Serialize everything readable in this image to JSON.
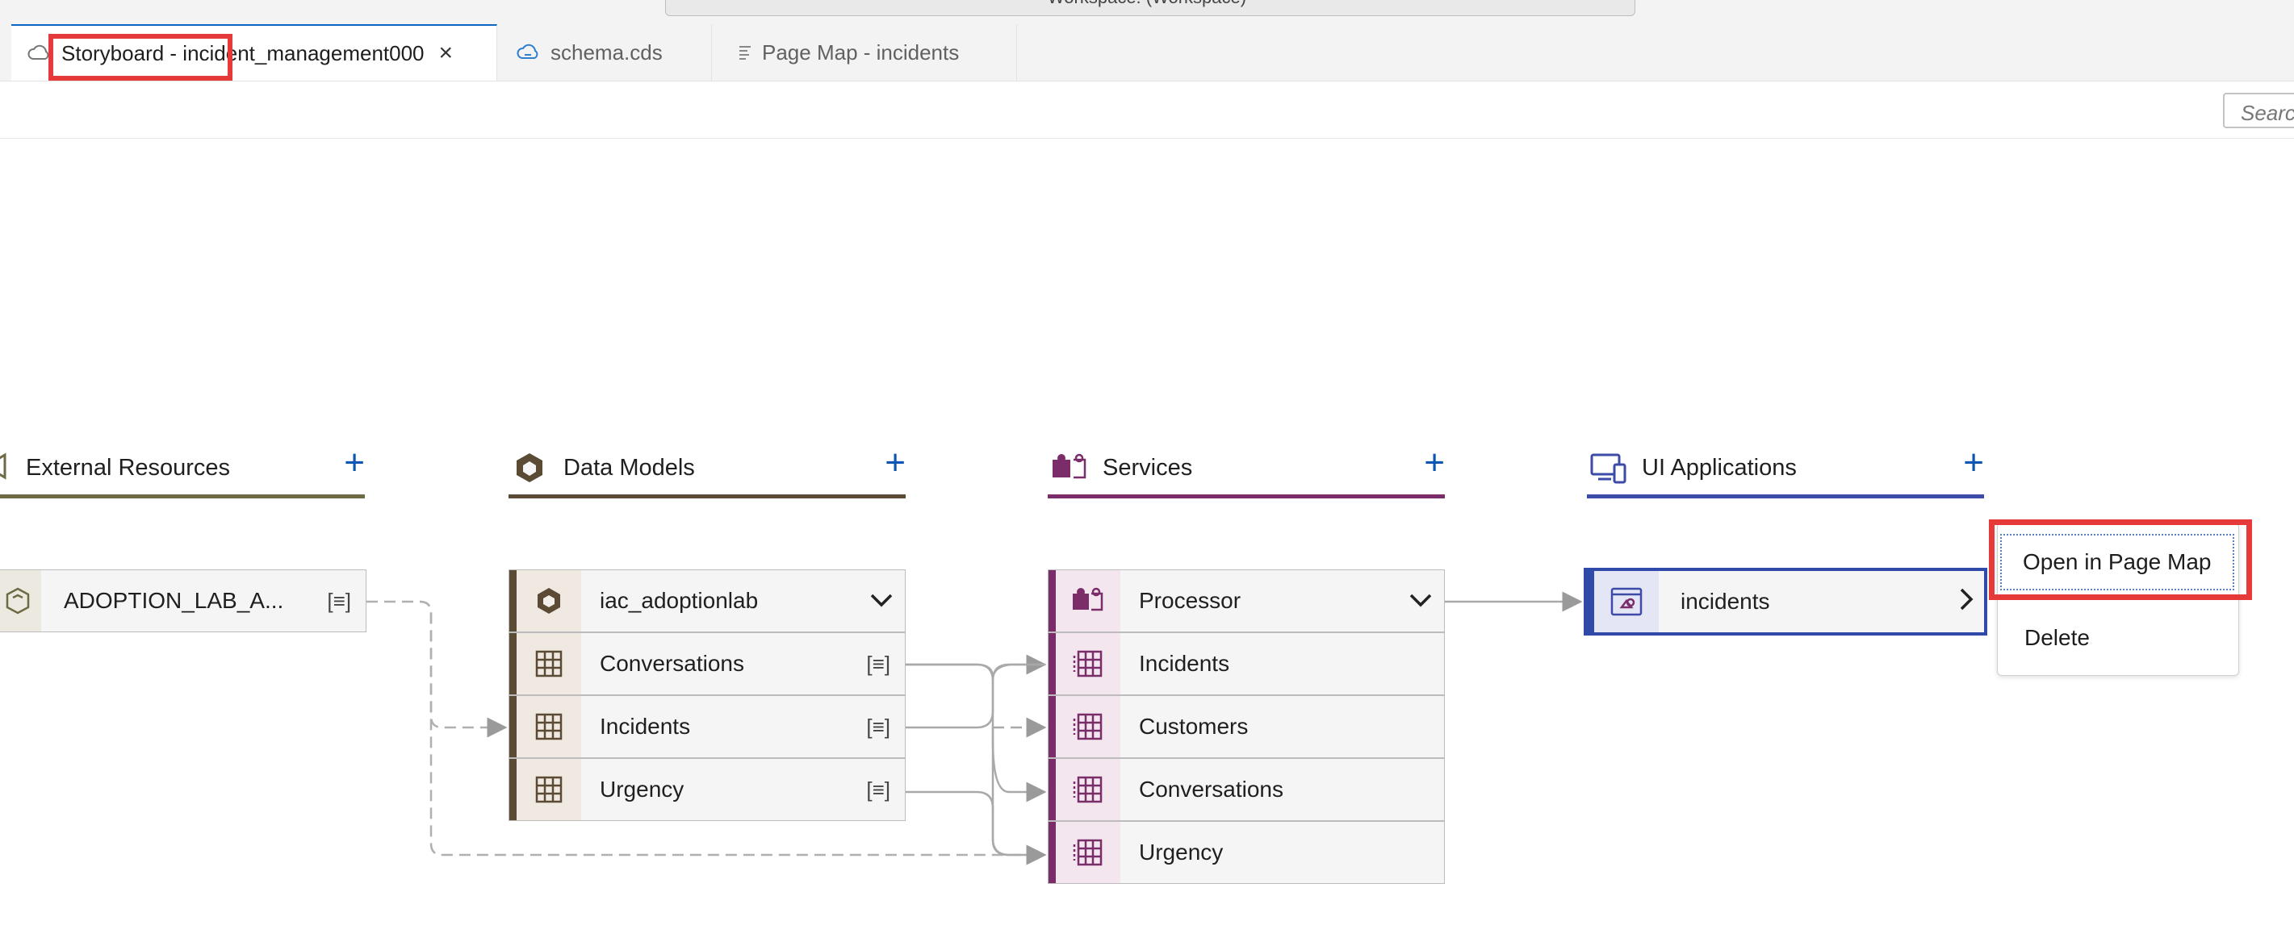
{
  "window": {
    "command_center_text": "Workspace: (Workspace)"
  },
  "tabs": [
    {
      "label": "Storyboard - incident_management000",
      "active": true,
      "icon": "storyboard-cloud-icon"
    },
    {
      "label": "schema.cds",
      "active": false,
      "icon": "cds-cloud-icon"
    },
    {
      "label": "Page Map - incidents",
      "active": false,
      "icon": "page-map-icon"
    }
  ],
  "toolbar": {
    "search_placeholder": "Search"
  },
  "columns": {
    "external": {
      "title": "External Resources",
      "color": "#6d6a44"
    },
    "models": {
      "title": "Data Models",
      "color": "#5b4a34"
    },
    "services": {
      "title": "Services",
      "color": "#7b2d6a"
    },
    "ui": {
      "title": "UI Applications",
      "color": "#3d4ba8"
    }
  },
  "external_resources": [
    {
      "label": "ADOPTION_LAB_A..."
    }
  ],
  "data_models": {
    "group": "iac_adoptionlab",
    "entities": [
      "Conversations",
      "Incidents",
      "Urgency"
    ]
  },
  "services": {
    "group": "Processor",
    "entities": [
      "Incidents",
      "Customers",
      "Conversations",
      "Urgency"
    ]
  },
  "ui_applications": [
    {
      "label": "incidents"
    }
  ],
  "context_menu": {
    "items": [
      "Open in Page Map",
      "Delete"
    ]
  },
  "icons": {
    "add": "+",
    "expand": "chevron-down-icon",
    "navigate": "chevron-right-icon",
    "details": "[≡]",
    "close": "×"
  }
}
